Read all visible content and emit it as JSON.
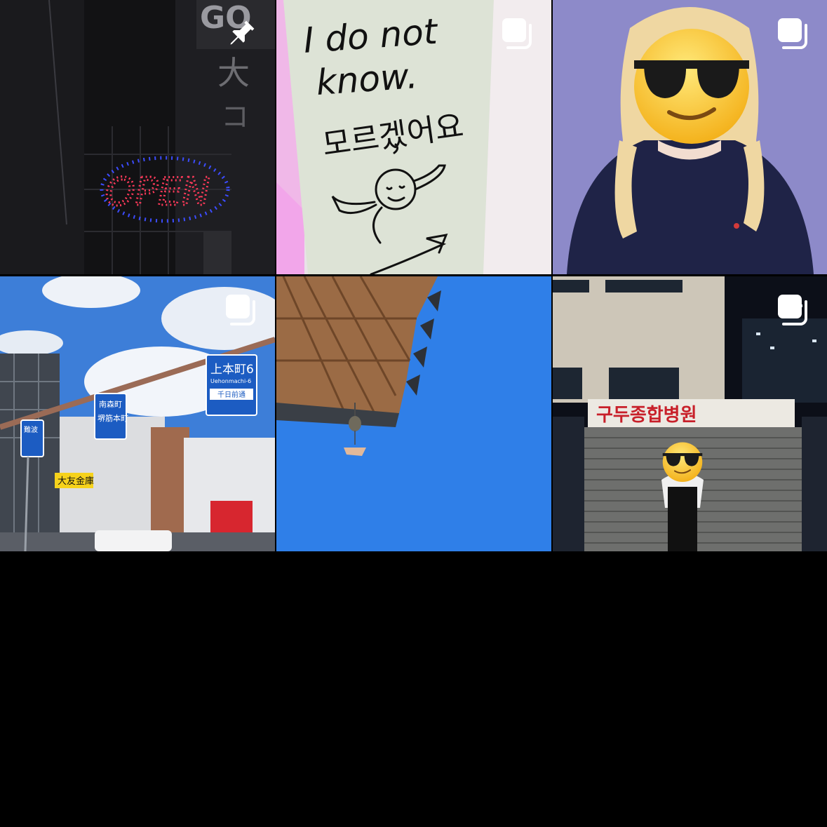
{
  "grid": {
    "posts": [
      {
        "name": "post-open-sign",
        "badge": "pin-icon",
        "sign_text": "OPEN",
        "bg_text_top": "GO",
        "bg_text_mid": "大",
        "bg_text_low": "コ"
      },
      {
        "name": "post-dont-know-sign",
        "badge": "multi-photo-icon",
        "line1": "I do not",
        "line2": "know.",
        "line3": "모르겠어요"
      },
      {
        "name": "post-portrait-emoji",
        "badge": "multi-photo-icon",
        "emoji": "😎"
      },
      {
        "name": "post-street-signs",
        "badge": "multi-photo-icon",
        "sign1_title": "上本町6",
        "sign1_sub": "Uehonmachi-6",
        "sign1_dir": "千日前通",
        "sign2_line1": "南森町",
        "sign2_line2": "堺筋本町",
        "sign3": "難波",
        "shop": "大友金庫"
      },
      {
        "name": "post-roof-sky",
        "badge": "none"
      },
      {
        "name": "post-hospital-night",
        "badge": "multi-photo-icon",
        "sign": "구두종합병원",
        "emoji": "😎"
      }
    ]
  },
  "colors": {
    "background": "#000000",
    "badge": "#ffffff",
    "sky": "#2f7fe8"
  }
}
